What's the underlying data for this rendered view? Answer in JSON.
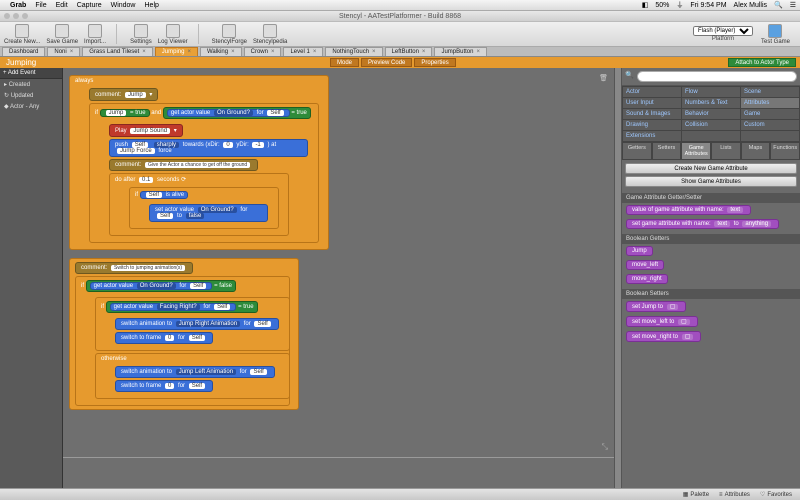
{
  "menubar": {
    "app": "Grab",
    "items": [
      "File",
      "Edit",
      "Capture",
      "Window",
      "Help"
    ],
    "right": [
      "50%",
      "Fri 9:54 PM",
      "Alex Mullis"
    ]
  },
  "window_title": "Stencyl - AATestPlatformer - Build 8868",
  "toolbar": {
    "tools": [
      "Create New...",
      "Save Game",
      "Import...",
      "Settings",
      "Log Viewer",
      "StencylForge",
      "Stencylpedia"
    ],
    "platform_label": "Platform",
    "platform_value": "Flash (Player)",
    "test_label": "Test Game"
  },
  "tabs": [
    "Dashboard",
    "Noni",
    "Grass Land Tileset",
    "Jumping",
    "Walking",
    "Crown",
    "Level 1",
    "NothingTouch",
    "LeftButton",
    "JumpButton"
  ],
  "active_tab": "Jumping",
  "subhead": {
    "title": "Jumping",
    "btns": [
      "Mode",
      "Preview Code",
      "Properties"
    ],
    "attach": "Attach to Actor Type"
  },
  "events": {
    "add": "+ Add Event",
    "items": [
      "Created",
      "Updated",
      "Actor - Any"
    ]
  },
  "blocks": {
    "always": "always",
    "comment1": "comment:",
    "comment1_field": "Jump",
    "if_jump": {
      "if": "if",
      "var": "Jump",
      "eq": "=",
      "true": "true",
      "and": "and",
      "get": "get actor value",
      "key": "On Ground?",
      "for": "for",
      "self": "Self",
      "eq2": "=",
      "true2": "true"
    },
    "play": {
      "play": "Play",
      "sound": "Jump Sound"
    },
    "push": {
      "push": "push",
      "self": "Self",
      "sharply": "sharply",
      "towards": "towards (xDir:",
      "x": "0",
      "y": "yDir:",
      "yv": "-1",
      ") at": ") at",
      "force": "Jump Force",
      "forcelbl": "force"
    },
    "comment2": "comment:",
    "comment2_field": "Give the Actor a chance to get off the ground",
    "doafter": {
      "do": "do after",
      "n": "0.1",
      "sec": "seconds"
    },
    "ifalive": {
      "if": "if",
      "self": "Self",
      "alive": "is alive"
    },
    "setval": {
      "set": "set actor value",
      "key": "On Ground?",
      "for": "for",
      "self": "Self",
      "to": "to",
      "false": "false"
    },
    "comment3": "comment:",
    "comment3_field": "Switch to jumping animation(s)",
    "ifleft": {
      "if": "if",
      "get": "get actor value",
      "key": "On Ground?",
      "for": "for",
      "self": "Self",
      "eq": "=",
      "false": "false"
    },
    "ifright": {
      "if": "if",
      "get": "get actor value",
      "key": "Facing Right?",
      "for": "for",
      "self": "Self",
      "eq": "=",
      "true": "true"
    },
    "switch_r": {
      "switch": "switch animation to",
      "anim": "Jump Right Animation",
      "for": "for",
      "self": "Self"
    },
    "frame_r": {
      "switch": "switch to frame",
      "n": "0",
      "for": "for",
      "self": "Self"
    },
    "otherwise": "otherwise",
    "switch_l": {
      "switch": "switch animation to",
      "anim": "Jump Left Animation",
      "for": "for",
      "self": "Self"
    },
    "frame_l": {
      "switch": "switch to frame",
      "n": "0",
      "for": "for",
      "self": "Self"
    }
  },
  "palette": {
    "search_placeholder": "",
    "categories": [
      [
        "Actor",
        "Flow",
        "Scene"
      ],
      [
        "User Input",
        "Numbers & Text",
        "Attributes"
      ],
      [
        "Sound & Images",
        "Behavior",
        "Game"
      ],
      [
        "Drawing",
        "Collision",
        "Custom"
      ],
      [
        "Extensions",
        "",
        ""
      ]
    ],
    "tabs": [
      "Getters",
      "Setters",
      "Game Attributes",
      "Lists",
      "Maps",
      "Functions"
    ],
    "active_tab": "Game Attributes",
    "btn_create": "Create New Game Attribute",
    "btn_show": "Show Game Attributes",
    "sec1": "Game Attribute Getter/Setter",
    "p1": "value of game attribute with name:",
    "p1_field": "text",
    "p2": "set game attribute with name:",
    "p2_field": "text",
    "p2_to": "to",
    "p2_v": "anything",
    "sec2": "Boolean Getters",
    "bools": [
      "Jump",
      "move_left",
      "move_right"
    ],
    "sec3": "Boolean Setters",
    "setters": [
      "set Jump to",
      "set move_left to",
      "set move_right to"
    ]
  },
  "bottom": {
    "palette": "Palette",
    "attributes": "Attributes",
    "favorites": "Favorites"
  }
}
